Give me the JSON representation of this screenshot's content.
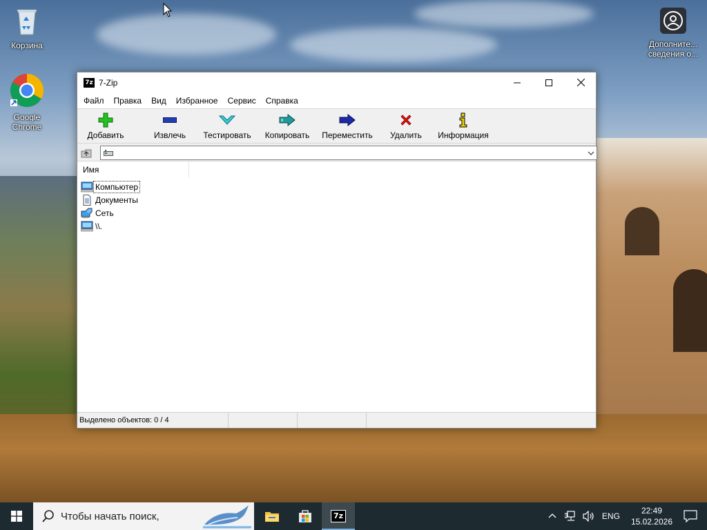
{
  "desktop": {
    "icons": [
      {
        "label": "Корзина"
      },
      {
        "label": "Google Chrome"
      },
      {
        "label": "Дополните... сведения о..."
      }
    ]
  },
  "window": {
    "title": "7-Zip",
    "app_icon_text": "7z",
    "controls": {
      "minimize": "—",
      "maximize": "☐",
      "close": "✕"
    }
  },
  "menu": [
    "Файл",
    "Правка",
    "Вид",
    "Избранное",
    "Сервис",
    "Справка"
  ],
  "toolbar": [
    {
      "label": "Добавить",
      "icon": "add-icon",
      "color": "#1fb31f"
    },
    {
      "label": "Извлечь",
      "icon": "extract-icon",
      "color": "#1f3fae"
    },
    {
      "label": "Тестировать",
      "icon": "test-icon",
      "color": "#23b6c6"
    },
    {
      "label": "Копировать",
      "icon": "copy-icon",
      "color": "#1f8f8f"
    },
    {
      "label": "Переместить",
      "icon": "move-icon",
      "color": "#1c2a9e"
    },
    {
      "label": "Удалить",
      "icon": "delete-icon",
      "color": "#e01010"
    },
    {
      "label": "Информация",
      "icon": "info-icon",
      "color": "#e6c800"
    }
  ],
  "address": {
    "value": ""
  },
  "list": {
    "column_name": "Имя",
    "items": [
      {
        "label": "Компьютер",
        "icon": "computer-icon",
        "focused": true
      },
      {
        "label": "Документы",
        "icon": "documents-icon",
        "focused": false
      },
      {
        "label": "Сеть",
        "icon": "network-icon",
        "focused": false
      },
      {
        "label": "\\\\.",
        "icon": "computer-icon",
        "focused": false
      }
    ]
  },
  "status": {
    "selected": "Выделено объектов: 0 / 4"
  },
  "taskbar": {
    "search_placeholder": "Чтобы начать поиск,",
    "lang": "ENG",
    "time": "22:49",
    "date": "15.02.2026"
  }
}
